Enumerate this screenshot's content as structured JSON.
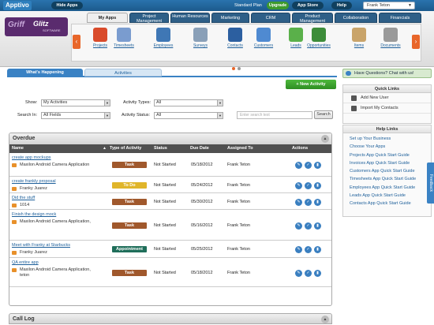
{
  "topbar": {
    "logo": "Apptivo",
    "hide_apps": "Hide Apps",
    "plan": "Standard Plan",
    "upgrade": "Upgrade",
    "app_store": "App Store",
    "help": "Help",
    "user": "Frank Teton"
  },
  "brand": {
    "line1": "Griff",
    "line2": "Glitz",
    "sub": "SOFTWARE"
  },
  "tabs": [
    {
      "label": "My Apps"
    },
    {
      "label": "Project Management"
    },
    {
      "label": "Human Resources"
    },
    {
      "label": "Marketing"
    },
    {
      "label": "CRM"
    },
    {
      "label": "Product Management"
    },
    {
      "label": "Collaboration"
    },
    {
      "label": "Financials"
    }
  ],
  "apps": [
    {
      "label": "Projects",
      "icon": "projects-icon",
      "color": "#d94b2b"
    },
    {
      "label": "Timesheets",
      "icon": "timesheets-icon",
      "color": "#7a9ccf"
    },
    {
      "label": "Employees",
      "icon": "employees-icon",
      "color": "#3f77b5"
    },
    {
      "label": "Surveys",
      "icon": "surveys-icon",
      "color": "#8aa0b8"
    },
    {
      "label": "Contacts",
      "icon": "contacts-icon",
      "color": "#2c5fa0"
    },
    {
      "label": "Customers",
      "icon": "customers-icon",
      "color": "#4f8ad1"
    },
    {
      "label": "Leads",
      "icon": "leads-icon",
      "color": "#5ab04a"
    },
    {
      "label": "Opportunities",
      "icon": "opportunities-icon",
      "color": "#3d8c3a"
    },
    {
      "label": "Items",
      "icon": "items-icon",
      "color": "#c9a46a"
    },
    {
      "label": "Documents",
      "icon": "documents-icon",
      "color": "#9a9a9a"
    }
  ],
  "subtabs": {
    "happening": "What's Happening",
    "activities": "Activities"
  },
  "new_activity": "+ New Activity",
  "filters": {
    "show_label": "Show:",
    "show_value": "My Activities",
    "types_label": "Activity Types:",
    "types_value": "All",
    "search_in_label": "Search In:",
    "search_in_value": "All Fields",
    "status_label": "Activity Status:",
    "status_value": "All",
    "search_placeholder": "Enter search text",
    "search_button": "Search"
  },
  "overdue": {
    "title": "Overdue",
    "columns": [
      "Name",
      "Type of Activity",
      "Status",
      "Due Date",
      "Assigned To",
      "Actions"
    ],
    "rows": [
      {
        "subject": "create app mockups",
        "related": "Maxilon Android Camera Application",
        "type": "Task",
        "type_color": "#a0582c",
        "status": "Not Started",
        "due": "05/18/2012",
        "assigned": "Frank Teton"
      },
      {
        "subject": "create frankly proposal",
        "related": "Franky Juarez",
        "type": "To Do",
        "type_color": "#e0b52a",
        "status": "Not Started",
        "due": "05/24/2012",
        "assigned": "Frank Teton"
      },
      {
        "subject": "Did the stuff",
        "related": "1014",
        "type": "Task",
        "type_color": "#a0582c",
        "status": "Not Started",
        "due": "05/30/2012",
        "assigned": "Frank Teton"
      },
      {
        "subject": "Finish the design mock",
        "related": "Maxilon Android Camera Application,",
        "type": "Task",
        "type_color": "#a0582c",
        "status": "Not Started",
        "due": "05/16/2012",
        "assigned": "Frank Teton"
      },
      {
        "subject": "Meet with Franky at Starbucks",
        "related": "Franky Juarez",
        "type": "Appointment",
        "type_color": "#1f6e5a",
        "status": "Not Started",
        "due": "05/25/2012",
        "assigned": "Frank Teton"
      },
      {
        "subject": "QA entire app",
        "related": "Maxilon Android Camera Application, teton",
        "type": "Task",
        "type_color": "#a0582c",
        "status": "Not Started",
        "due": "05/18/2012",
        "assigned": "Frank Teton"
      }
    ]
  },
  "call_log": "Call Log",
  "sidebar": {
    "chat": "Have Questions? Chat with us!",
    "quick_links_title": "Quick Links",
    "quick_links": [
      "Add New User",
      "Import My Contacts"
    ],
    "help_links_title": "Help Links",
    "help_links": [
      "Set up Your Business",
      "Choose Your Apps",
      "Projects App Quick Start Guide",
      "Invoices App Quick Start Guide",
      "Customers App Quick Start Guide",
      "Timesheets App Quick Start Guide",
      "Employees App Quick Start Guide",
      "Leads App Quick Start Guide",
      "Contacts App Quick Start Guide"
    ]
  },
  "feedback": "Feedback"
}
